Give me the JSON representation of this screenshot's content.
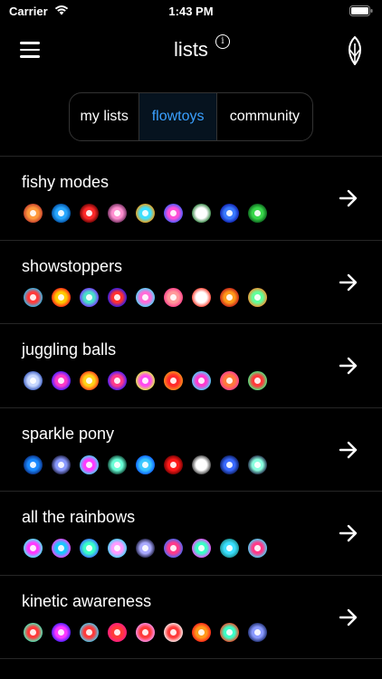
{
  "status": {
    "carrier": "Carrier",
    "time": "1:43 PM"
  },
  "nav": {
    "title": "lists",
    "info_symbol": "i"
  },
  "tabs": [
    {
      "label": "my lists",
      "selected": false
    },
    {
      "label": "flowtoys",
      "selected": true
    },
    {
      "label": "community",
      "selected": false
    }
  ],
  "colors": {
    "accent": "#3aa0ff",
    "background": "#000000",
    "divider": "#262626"
  },
  "lists": [
    {
      "title": "fishy modes",
      "swatches": [
        [
          "#ff9a3c",
          "#c03a2b"
        ],
        [
          "#28a8ff",
          "#004a9c"
        ],
        [
          "#ff2a2a",
          "#600000"
        ],
        [
          "#ff8fd0",
          "#6b2b5a"
        ],
        [
          "#3de0ff",
          "#ff9a00"
        ],
        [
          "#ff4fd8",
          "#3a5bff"
        ],
        [
          "#ffffff",
          "#2b7f3a"
        ],
        [
          "#3a7bff",
          "#0b1aa8"
        ],
        [
          "#38d84a",
          "#0a5a1a"
        ]
      ]
    },
    {
      "title": "showstoppers",
      "swatches": [
        [
          "#ff3a3a",
          "#1ac8ff"
        ],
        [
          "#ffcc00",
          "#ff1a1a"
        ],
        [
          "#49e0c8",
          "#7a2bff"
        ],
        [
          "#ff3030",
          "#1a1aff"
        ],
        [
          "#ff6bd8",
          "#40e0ff"
        ],
        [
          "#ff9a9a",
          "#ff3a8a"
        ],
        [
          "#ffffff",
          "#ff3a2a"
        ],
        [
          "#ff9a1a",
          "#c01a1a"
        ],
        [
          "#60ff9a",
          "#ff8a2a"
        ]
      ]
    },
    {
      "title": "juggling balls",
      "swatches": [
        [
          "#c8d8ff",
          "#3a5bbf"
        ],
        [
          "#ff3ac8",
          "#3a1aff"
        ],
        [
          "#ffd41a",
          "#ff3a1a"
        ],
        [
          "#ff3a8a",
          "#3a1aff"
        ],
        [
          "#ff4af0",
          "#e0ff3a"
        ],
        [
          "#ff2a2a",
          "#ff9a1a"
        ],
        [
          "#ff3ad0",
          "#3ae0ff"
        ],
        [
          "#ff7a3a",
          "#ff3a9a"
        ],
        [
          "#ff3a3a",
          "#3aff8a"
        ]
      ]
    },
    {
      "title": "sparkle pony",
      "swatches": [
        [
          "#1a8aff",
          "#0a2a7a"
        ],
        [
          "#8a9aff",
          "#1a1a3a"
        ],
        [
          "#ff3aff",
          "#3ae0ff"
        ],
        [
          "#6affd8",
          "#0a3a2a"
        ],
        [
          "#3ac8ff",
          "#0a5aff"
        ],
        [
          "#ff1a1a",
          "#6a0000"
        ],
        [
          "#ffffff",
          "#3a3a3a"
        ],
        [
          "#3a6aff",
          "#0a1a5a"
        ],
        [
          "#8affe0",
          "#1a1a3a"
        ]
      ]
    },
    {
      "title": "all the rainbows",
      "swatches": [
        [
          "#ff3aff",
          "#3affff"
        ],
        [
          "#1ac8ff",
          "#ff3aff"
        ],
        [
          "#3affc8",
          "#3a6aff"
        ],
        [
          "#ff9aff",
          "#3ad8ff"
        ],
        [
          "#aaaaff",
          "#1a1a3a"
        ],
        [
          "#ff3a8a",
          "#3a6aff"
        ],
        [
          "#3affc8",
          "#ff3aff"
        ],
        [
          "#3ae0ff",
          "#1a8a8a"
        ],
        [
          "#ff3a8a",
          "#3ae0ff"
        ]
      ]
    },
    {
      "title": "kinetic awareness",
      "swatches": [
        [
          "#ff3a3a",
          "#3affc8"
        ],
        [
          "#ff3aff",
          "#3a1aff"
        ],
        [
          "#ff3a3a",
          "#3ad8ff"
        ],
        [
          "#ff3a3a",
          "#ff1a8a"
        ],
        [
          "#ff3a3a",
          "#ff9aff"
        ],
        [
          "#ff3a3a",
          "#ffffff"
        ],
        [
          "#ff9a1a",
          "#ff1a1a"
        ],
        [
          "#3affc8",
          "#ff3a1a"
        ],
        [
          "#8a9aff",
          "#1a2a6a"
        ]
      ]
    }
  ]
}
